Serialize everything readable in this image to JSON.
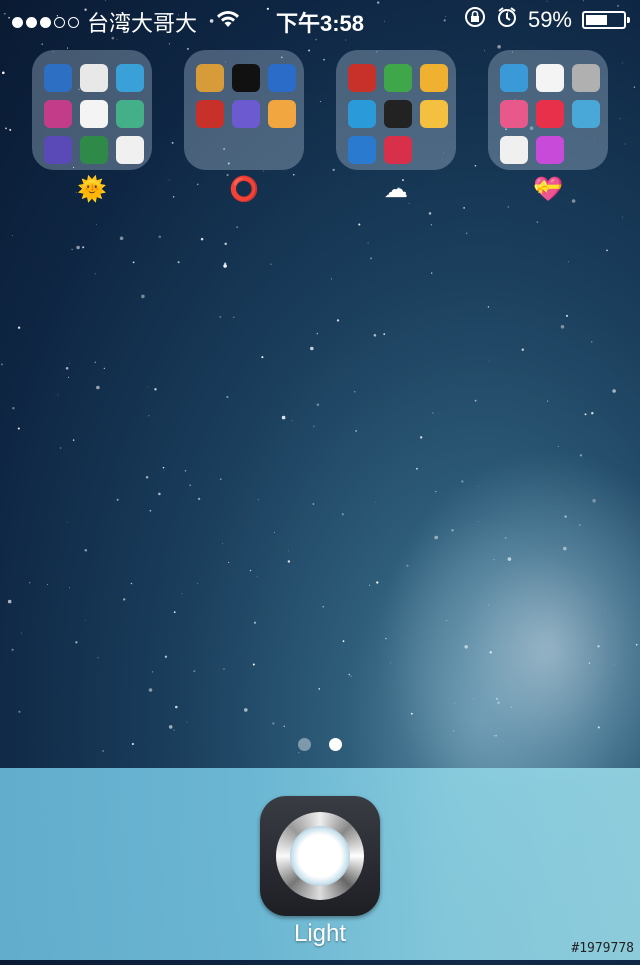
{
  "status_bar": {
    "carrier": "台湾大哥大",
    "signal_bars_filled": 3,
    "signal_bars_total": 5,
    "time": "下午3:58",
    "battery_percent": "59%",
    "battery_level": 0.59,
    "icons": [
      "wifi-icon",
      "rotation-lock-icon",
      "alarm-icon",
      "battery-icon"
    ]
  },
  "folders": [
    {
      "label": "🌞",
      "apps": [
        "#2d6fc2",
        "#e8e8e8",
        "#3aa0d8",
        "#c23c8a",
        "#f4f4f4",
        "#43b08a",
        "#5a4ab8",
        "#2f8a4a",
        "#f0f0f0"
      ]
    },
    {
      "label": "⭕",
      "apps": [
        "#d89b3a",
        "#111111",
        "#2a6cc8",
        "#c8302a",
        "#6c5ad0",
        "#f2a640"
      ]
    },
    {
      "label": "☁",
      "apps": [
        "#c8302a",
        "#3fa64a",
        "#f0b030",
        "#2a9ad8",
        "#222222",
        "#f5c040",
        "#2a7ad0",
        "#d8304a"
      ]
    },
    {
      "label": "💝",
      "apps": [
        "#3a9ad8",
        "#f4f4f4",
        "#b0b0b0",
        "#e8588a",
        "#e8304a",
        "#4aa8d8",
        "#f0f0f0",
        "#c84ad8"
      ]
    }
  ],
  "pages": {
    "count": 2,
    "current": 2
  },
  "dock": {
    "app_name": "Light"
  },
  "watermark": "#1979778",
  "colors": {
    "dock": "#72c0dc",
    "wallpaper": "#1a3e5c"
  }
}
